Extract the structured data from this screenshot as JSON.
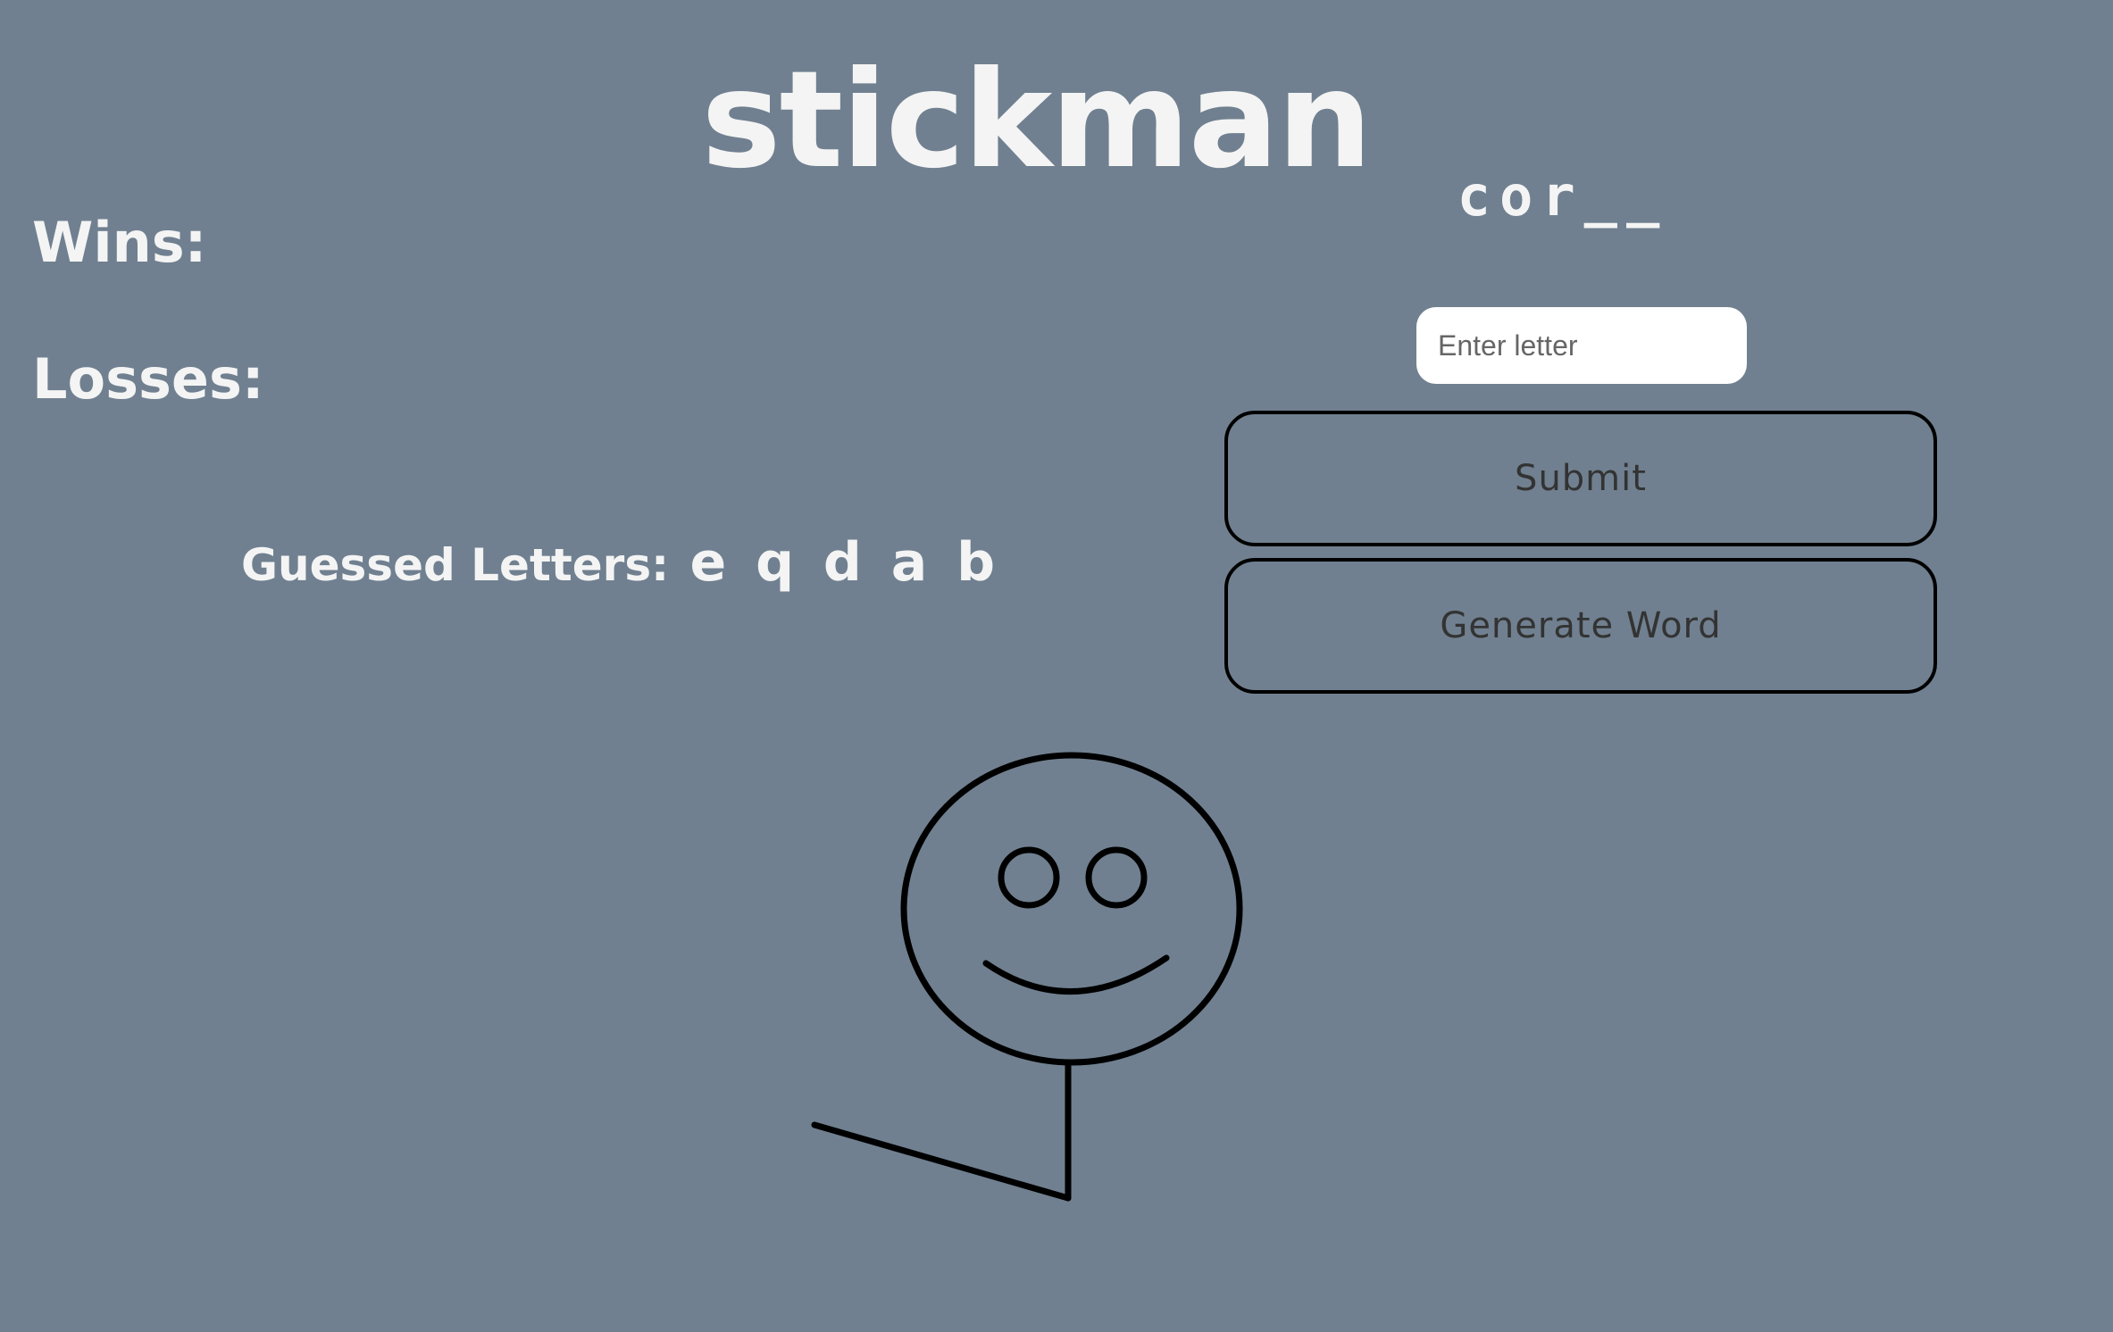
{
  "header": {
    "title": "stickman"
  },
  "game": {
    "word_display": "cor__",
    "wins_label": "Wins:",
    "losses_label": "Losses:",
    "guessed_label": "Guessed Letters:",
    "guessed_letters": "e q d a b"
  },
  "controls": {
    "input_placeholder": "Enter letter",
    "input_value": "",
    "submit_label": "Submit",
    "generate_label": "Generate Word"
  },
  "drawing": {
    "parts_shown": [
      "head",
      "eyes",
      "smile",
      "body",
      "left-leg"
    ],
    "stroke_color": "#000000"
  },
  "colors": {
    "background": "#708090",
    "text": "#f4f4f4",
    "button_text": "#333333",
    "button_border": "#000000",
    "input_background": "#ffffff"
  }
}
